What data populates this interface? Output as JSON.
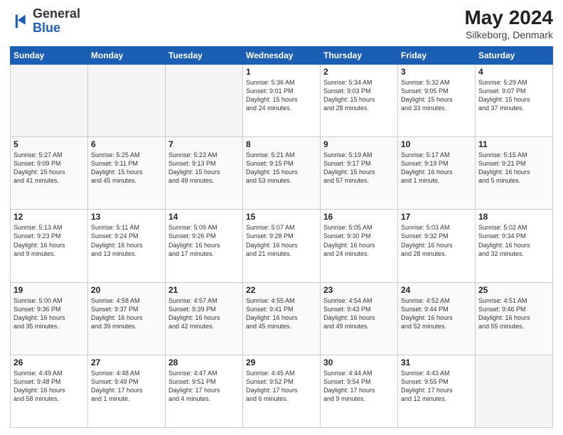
{
  "header": {
    "logo_general": "General",
    "logo_blue": "Blue",
    "month_year": "May 2024",
    "location": "Silkeborg, Denmark"
  },
  "days_of_week": [
    "Sunday",
    "Monday",
    "Tuesday",
    "Wednesday",
    "Thursday",
    "Friday",
    "Saturday"
  ],
  "weeks": [
    [
      {
        "num": "",
        "info": ""
      },
      {
        "num": "",
        "info": ""
      },
      {
        "num": "",
        "info": ""
      },
      {
        "num": "1",
        "info": "Sunrise: 5:36 AM\nSunset: 9:01 PM\nDaylight: 15 hours\nand 24 minutes."
      },
      {
        "num": "2",
        "info": "Sunrise: 5:34 AM\nSunset: 9:03 PM\nDaylight: 15 hours\nand 28 minutes."
      },
      {
        "num": "3",
        "info": "Sunrise: 5:32 AM\nSunset: 9:05 PM\nDaylight: 15 hours\nand 33 minutes."
      },
      {
        "num": "4",
        "info": "Sunrise: 5:29 AM\nSunset: 9:07 PM\nDaylight: 15 hours\nand 37 minutes."
      }
    ],
    [
      {
        "num": "5",
        "info": "Sunrise: 5:27 AM\nSunset: 9:09 PM\nDaylight: 15 hours\nand 41 minutes."
      },
      {
        "num": "6",
        "info": "Sunrise: 5:25 AM\nSunset: 9:11 PM\nDaylight: 15 hours\nand 45 minutes."
      },
      {
        "num": "7",
        "info": "Sunrise: 5:23 AM\nSunset: 9:13 PM\nDaylight: 15 hours\nand 49 minutes."
      },
      {
        "num": "8",
        "info": "Sunrise: 5:21 AM\nSunset: 9:15 PM\nDaylight: 15 hours\nand 53 minutes."
      },
      {
        "num": "9",
        "info": "Sunrise: 5:19 AM\nSunset: 9:17 PM\nDaylight: 15 hours\nand 57 minutes."
      },
      {
        "num": "10",
        "info": "Sunrise: 5:17 AM\nSunset: 9:19 PM\nDaylight: 16 hours\nand 1 minute."
      },
      {
        "num": "11",
        "info": "Sunrise: 5:15 AM\nSunset: 9:21 PM\nDaylight: 16 hours\nand 5 minutes."
      }
    ],
    [
      {
        "num": "12",
        "info": "Sunrise: 5:13 AM\nSunset: 9:23 PM\nDaylight: 16 hours\nand 9 minutes."
      },
      {
        "num": "13",
        "info": "Sunrise: 5:11 AM\nSunset: 9:24 PM\nDaylight: 16 hours\nand 13 minutes."
      },
      {
        "num": "14",
        "info": "Sunrise: 5:09 AM\nSunset: 9:26 PM\nDaylight: 16 hours\nand 17 minutes."
      },
      {
        "num": "15",
        "info": "Sunrise: 5:07 AM\nSunset: 9:28 PM\nDaylight: 16 hours\nand 21 minutes."
      },
      {
        "num": "16",
        "info": "Sunrise: 5:05 AM\nSunset: 9:30 PM\nDaylight: 16 hours\nand 24 minutes."
      },
      {
        "num": "17",
        "info": "Sunrise: 5:03 AM\nSunset: 9:32 PM\nDaylight: 16 hours\nand 28 minutes."
      },
      {
        "num": "18",
        "info": "Sunrise: 5:02 AM\nSunset: 9:34 PM\nDaylight: 16 hours\nand 32 minutes."
      }
    ],
    [
      {
        "num": "19",
        "info": "Sunrise: 5:00 AM\nSunset: 9:36 PM\nDaylight: 16 hours\nand 35 minutes."
      },
      {
        "num": "20",
        "info": "Sunrise: 4:58 AM\nSunset: 9:37 PM\nDaylight: 16 hours\nand 39 minutes."
      },
      {
        "num": "21",
        "info": "Sunrise: 4:57 AM\nSunset: 9:39 PM\nDaylight: 16 hours\nand 42 minutes."
      },
      {
        "num": "22",
        "info": "Sunrise: 4:55 AM\nSunset: 9:41 PM\nDaylight: 16 hours\nand 45 minutes."
      },
      {
        "num": "23",
        "info": "Sunrise: 4:54 AM\nSunset: 9:43 PM\nDaylight: 16 hours\nand 49 minutes."
      },
      {
        "num": "24",
        "info": "Sunrise: 4:52 AM\nSunset: 9:44 PM\nDaylight: 16 hours\nand 52 minutes."
      },
      {
        "num": "25",
        "info": "Sunrise: 4:51 AM\nSunset: 9:46 PM\nDaylight: 16 hours\nand 55 minutes."
      }
    ],
    [
      {
        "num": "26",
        "info": "Sunrise: 4:49 AM\nSunset: 9:48 PM\nDaylight: 16 hours\nand 58 minutes."
      },
      {
        "num": "27",
        "info": "Sunrise: 4:48 AM\nSunset: 9:49 PM\nDaylight: 17 hours\nand 1 minute."
      },
      {
        "num": "28",
        "info": "Sunrise: 4:47 AM\nSunset: 9:51 PM\nDaylight: 17 hours\nand 4 minutes."
      },
      {
        "num": "29",
        "info": "Sunrise: 4:45 AM\nSunset: 9:52 PM\nDaylight: 17 hours\nand 6 minutes."
      },
      {
        "num": "30",
        "info": "Sunrise: 4:44 AM\nSunset: 9:54 PM\nDaylight: 17 hours\nand 9 minutes."
      },
      {
        "num": "31",
        "info": "Sunrise: 4:43 AM\nSunset: 9:55 PM\nDaylight: 17 hours\nand 12 minutes."
      },
      {
        "num": "",
        "info": ""
      }
    ]
  ]
}
